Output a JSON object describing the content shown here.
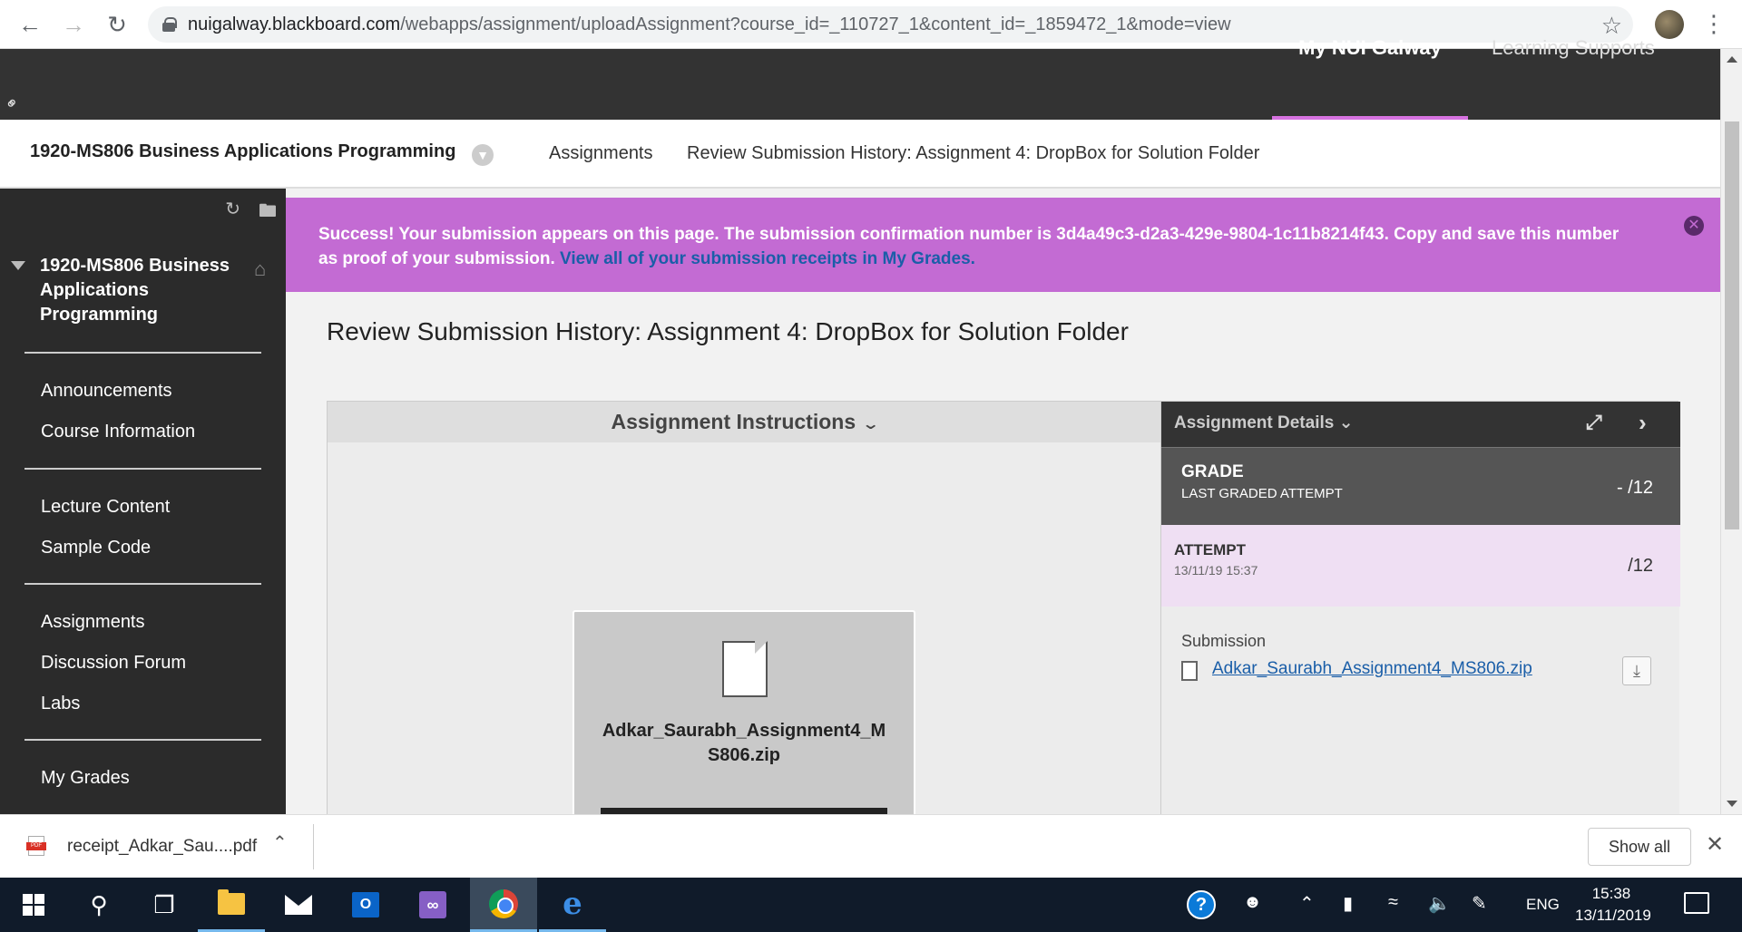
{
  "browser": {
    "url_host": "nuigalway.blackboard.com",
    "url_path": "/webapps/assignment/uploadAssignment?course_id=_110727_1&content_id=_1859472_1&mode=view"
  },
  "top_nav": {
    "active_tab": "My NUI Galway",
    "support_tab": "Learning Supports"
  },
  "breadcrumb": {
    "course": "1920-MS806 Business Applications Programming",
    "items": [
      "Assignments",
      "Review Submission History: Assignment 4: DropBox for Solution Folder"
    ]
  },
  "sidebar": {
    "course_title": "1920-MS806 Business Applications Programming",
    "groups": [
      [
        "Announcements",
        "Course Information"
      ],
      [
        "Lecture Content",
        "Sample Code"
      ],
      [
        "Assignments",
        "Discussion Forum",
        "Labs"
      ],
      [
        "My Grades"
      ]
    ]
  },
  "banner": {
    "message": "Success! Your submission appears on this page. The submission confirmation number is 3d4a49c3-d2a3-429e-9804-1c11b8214f43. Copy and save this number as proof of your submission.",
    "link": "View all of your submission receipts in My Grades."
  },
  "page": {
    "title": "Review Submission History: Assignment 4: DropBox for Solution Folder"
  },
  "instructions": {
    "header": "Assignment Instructions",
    "file_name": "Adkar_Saurabh_Assignment4_MS806.zip"
  },
  "details": {
    "header": "Assignment Details",
    "grade_label": "GRADE",
    "grade_sub": "LAST GRADED ATTEMPT",
    "grade_value": "- /12",
    "attempt_label": "ATTEMPT",
    "attempt_date": "13/11/19 15:37",
    "attempt_value": "/12",
    "submission_label": "Submission",
    "submission_file": "Adkar_Saurabh_Assignment4_MS806.zip"
  },
  "download_shelf": {
    "file": "receipt_Adkar_Sau....pdf",
    "show_all": "Show all"
  },
  "taskbar": {
    "language": "ENG",
    "time": "15:38",
    "date": "13/11/2019"
  }
}
